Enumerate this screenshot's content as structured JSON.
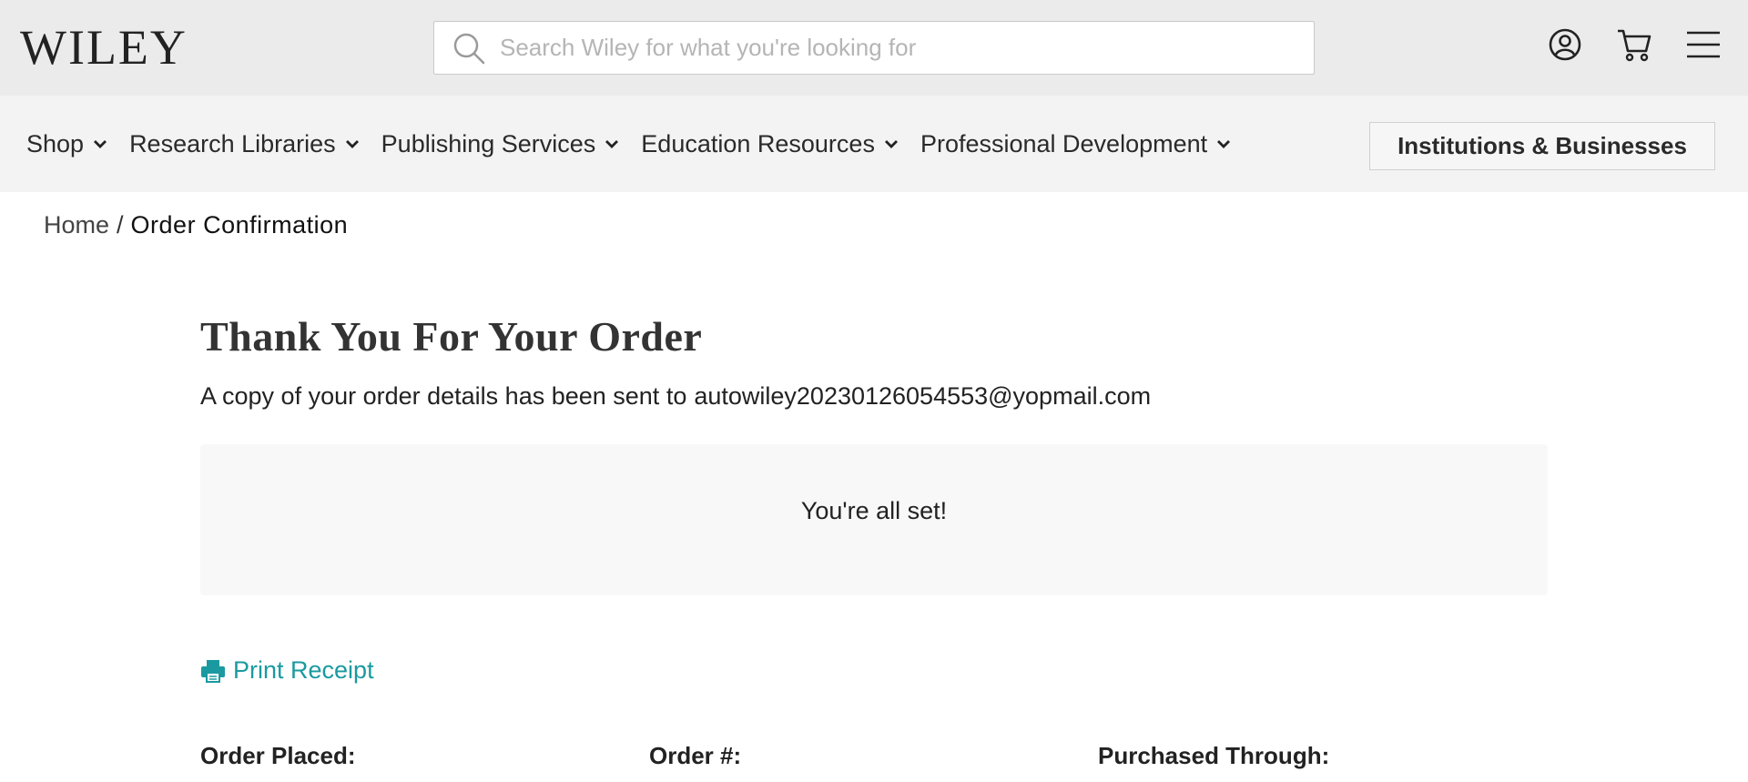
{
  "header": {
    "logo_text": "WILEY",
    "search_placeholder": "Search Wiley for what you're looking for",
    "icons": [
      "search-icon",
      "account-icon",
      "cart-icon",
      "menu-icon"
    ]
  },
  "nav": {
    "items": [
      {
        "label": "Shop"
      },
      {
        "label": "Research Libraries"
      },
      {
        "label": "Publishing Services"
      },
      {
        "label": "Education Resources"
      },
      {
        "label": "Professional Development"
      }
    ],
    "institutions_button": "Institutions & Businesses"
  },
  "breadcrumb": {
    "home": "Home",
    "separator": "/",
    "current": "Order Confirmation"
  },
  "main": {
    "title": "Thank You For Your Order",
    "sent_prefix": "A copy of your order details has been sent to",
    "email": "autowiley20230126054553@yopmail.com",
    "status_message": "You're all set!",
    "print_label": "Print Receipt",
    "details": {
      "order_placed_label": "Order Placed:",
      "order_number_label": "Order #:",
      "purchased_through_label": "Purchased Through:"
    }
  },
  "colors": {
    "topbar_bg": "#ebebeb",
    "navbar_bg": "#f3f3f3",
    "accent_link": "#1a9aa0",
    "status_box_bg": "#f8f8f8"
  }
}
